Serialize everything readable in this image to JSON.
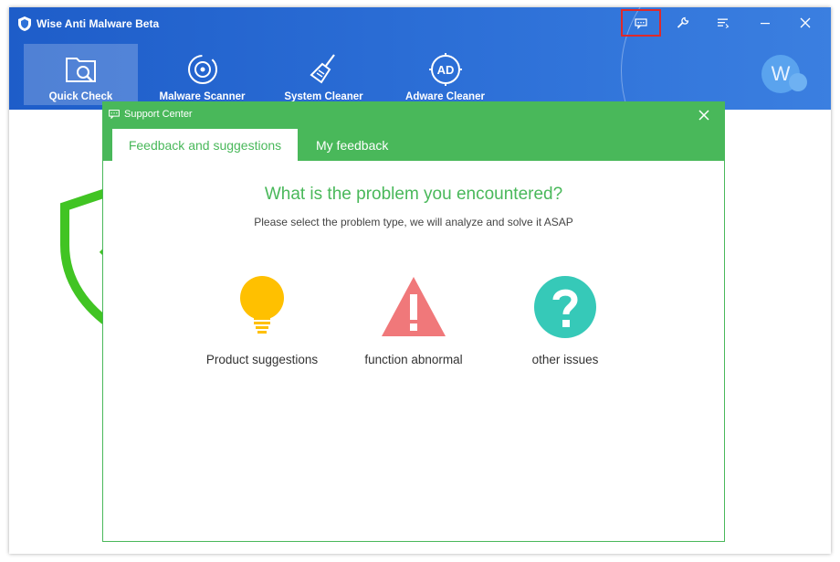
{
  "app": {
    "title": "Wise Anti Malware Beta",
    "brand_color": "#2e71d8"
  },
  "titlebar": {
    "buttons": [
      {
        "name": "feedback",
        "icon": "chat-icon"
      },
      {
        "name": "tools",
        "icon": "wrench-icon"
      },
      {
        "name": "menu",
        "icon": "menu-icon"
      },
      {
        "name": "minimize",
        "icon": "minimize-icon"
      },
      {
        "name": "close",
        "icon": "close-icon"
      }
    ]
  },
  "nav": {
    "items": [
      {
        "label": "Quick Check",
        "icon": "folder-search-icon",
        "active": true
      },
      {
        "label": "Malware Scanner",
        "icon": "radar-icon",
        "active": false
      },
      {
        "label": "System Cleaner",
        "icon": "broom-icon",
        "active": false
      },
      {
        "label": "Adware Cleaner",
        "icon": "ad-icon",
        "active": false
      }
    ]
  },
  "avatar": {
    "letter": "W"
  },
  "dialog": {
    "title": "Support Center",
    "accent": "#49b85a",
    "tabs": [
      {
        "label": "Feedback and suggestions",
        "active": true
      },
      {
        "label": "My feedback",
        "active": false
      }
    ],
    "headline": "What is the problem you encountered?",
    "subline": "Please select the problem type, we will analyze and solve it ASAP",
    "options": [
      {
        "label": "Product suggestions",
        "icon": "lightbulb-icon",
        "color": "#ffc000"
      },
      {
        "label": "function abnormal",
        "icon": "warning-icon",
        "color": "#f0787a"
      },
      {
        "label": "other issues",
        "icon": "question-icon",
        "color": "#36c9b8"
      }
    ]
  }
}
